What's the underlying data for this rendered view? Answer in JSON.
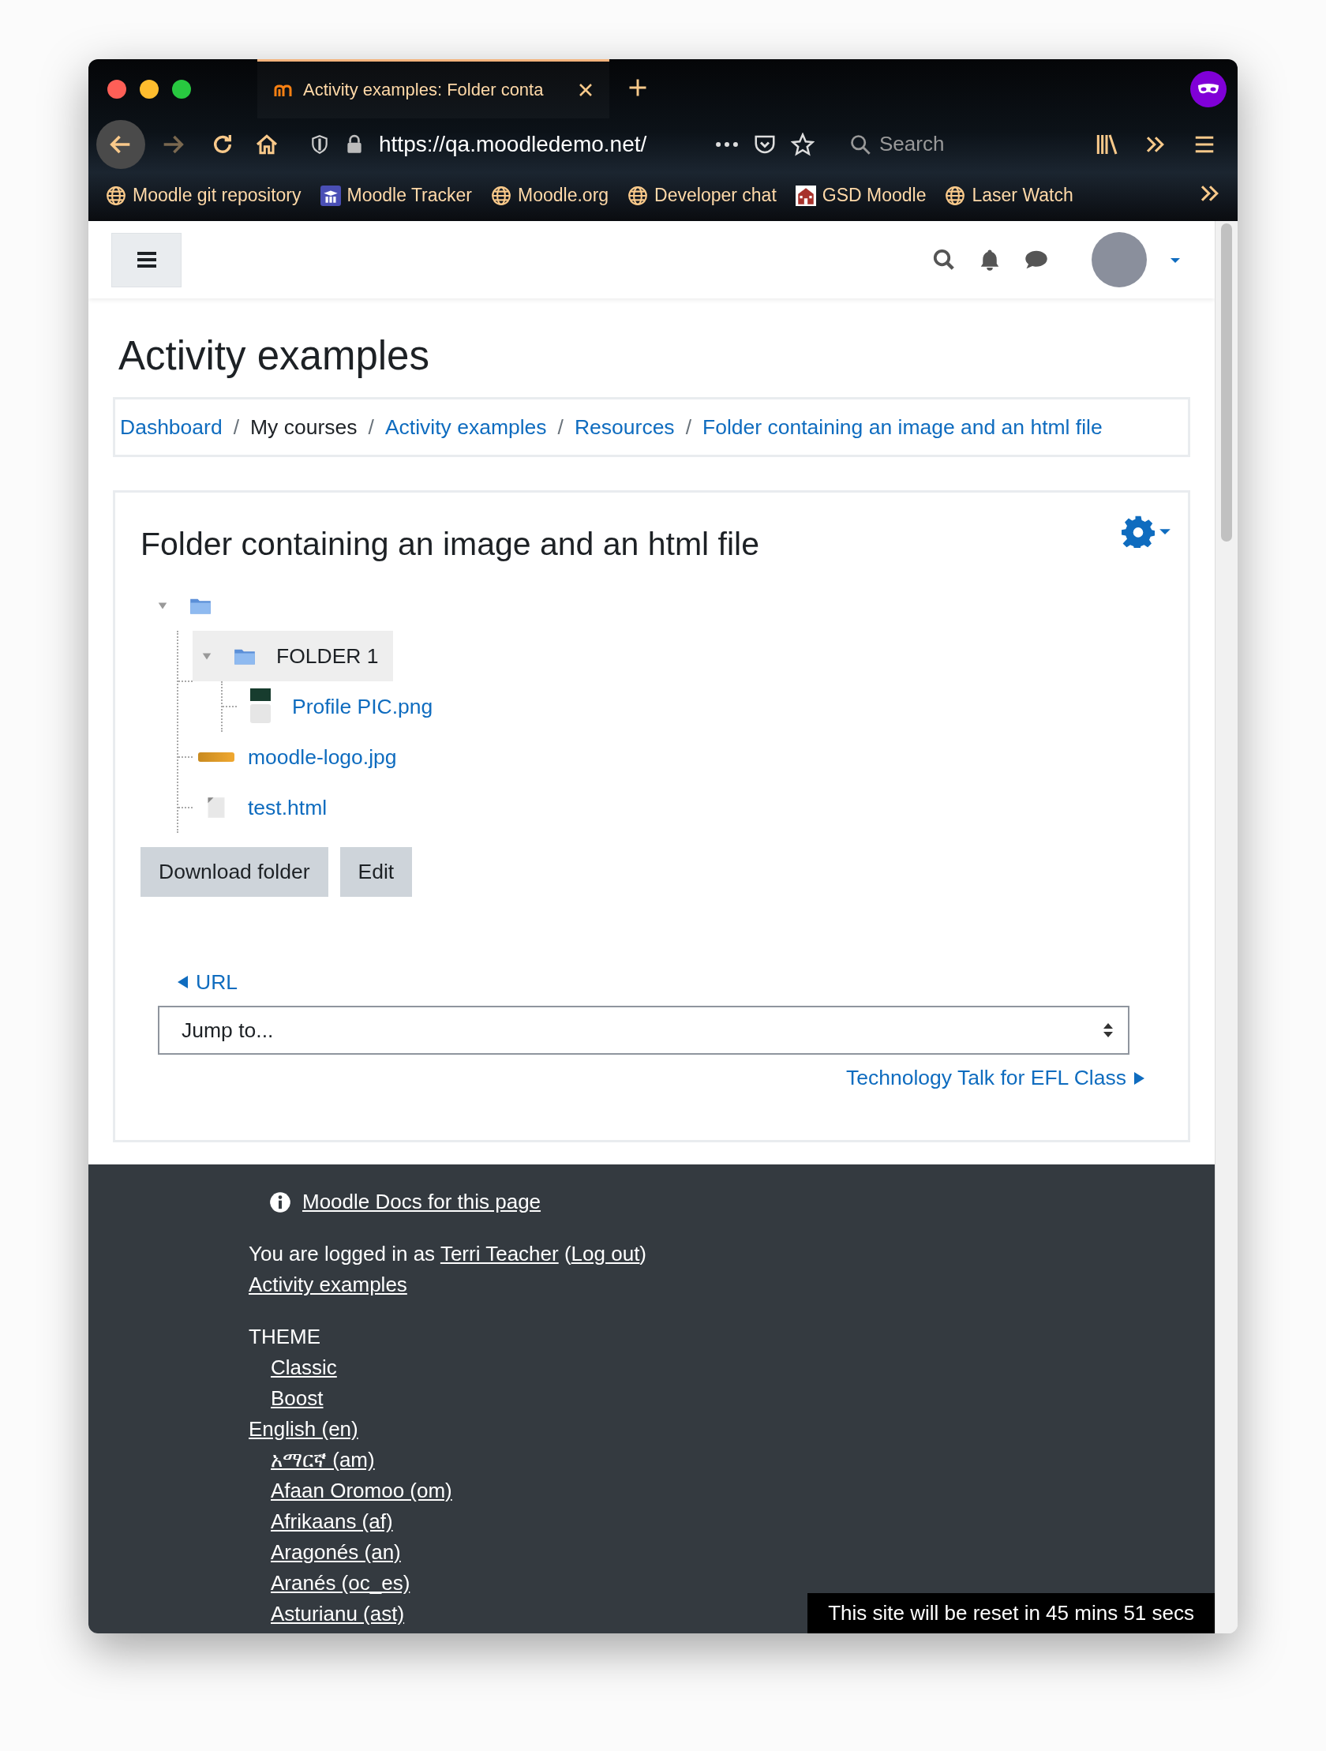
{
  "browser": {
    "tab": {
      "title": "Activity examples: Folder conta",
      "selected": true
    },
    "navigation": [
      {
        "kind": "back",
        "disabled": false
      },
      {
        "kind": "forward",
        "disabled": true
      }
    ],
    "url": "https://qa.moodledemo.net/",
    "search": {
      "placeholder": "Search"
    },
    "bookmarks": [
      {
        "kind": "globe",
        "label": "Moodle git repository"
      },
      {
        "kind": "tracker",
        "label": "Moodle Tracker"
      },
      {
        "kind": "globe",
        "label": "Moodle.org"
      },
      {
        "kind": "globe",
        "label": "Developer chat"
      },
      {
        "kind": "building",
        "label": "GSD Moodle"
      },
      {
        "kind": "globe",
        "label": "Laser Watch"
      }
    ]
  },
  "page": {
    "heading": "Activity examples",
    "breadcrumb": [
      {
        "kind": "link",
        "label": "Dashboard"
      },
      {
        "kind": "text",
        "label": "My courses",
        "separator": "/"
      },
      {
        "kind": "link",
        "label": "Activity examples",
        "separator": "/"
      },
      {
        "kind": "link",
        "label": "Resources",
        "separator": "/"
      },
      {
        "kind": "link",
        "label": "Folder containing an image and an html file",
        "separator": "/"
      }
    ],
    "folder": {
      "title": "Folder containing an image and an html file",
      "tree": {
        "kind": "folder",
        "expanded": true,
        "selected": false,
        "children": [
          {
            "kind": "folder",
            "label": "FOLDER 1",
            "expanded": true,
            "selected": true,
            "children": [
              {
                "kind": "photo",
                "label": "Profile PIC.png",
                "selected": false
              }
            ]
          },
          {
            "kind": "logo",
            "label": "moodle-logo.jpg",
            "selected": false
          },
          {
            "kind": "file",
            "label": "test.html",
            "selected": false
          }
        ]
      },
      "buttons": [
        "Download folder",
        "Edit"
      ]
    },
    "activity_nav": {
      "previous": "URL",
      "jump": {
        "placeholder": "Jump to..."
      },
      "next": "Technology Talk for EFL Class"
    }
  },
  "footer": {
    "docs_link": "Moodle Docs for this page",
    "login": {
      "prefix": "You are logged in as",
      "user": "Terri Teacher",
      "open": "(",
      "logout": "Log out",
      "close": ")"
    },
    "course_link": "Activity examples",
    "theme": {
      "label": "THEME",
      "options": [
        "Classic",
        "Boost"
      ]
    },
    "language": {
      "label": "English (en)",
      "options": [
        "አማርኛ (am)",
        "Afaan Oromoo (om)",
        "Afrikaans (af)",
        "Aragonés (an)",
        "Aranés (oc_es)",
        "Asturianu (ast)"
      ]
    },
    "reset_notice": "This site will be reset in 45 mins 51 secs"
  }
}
